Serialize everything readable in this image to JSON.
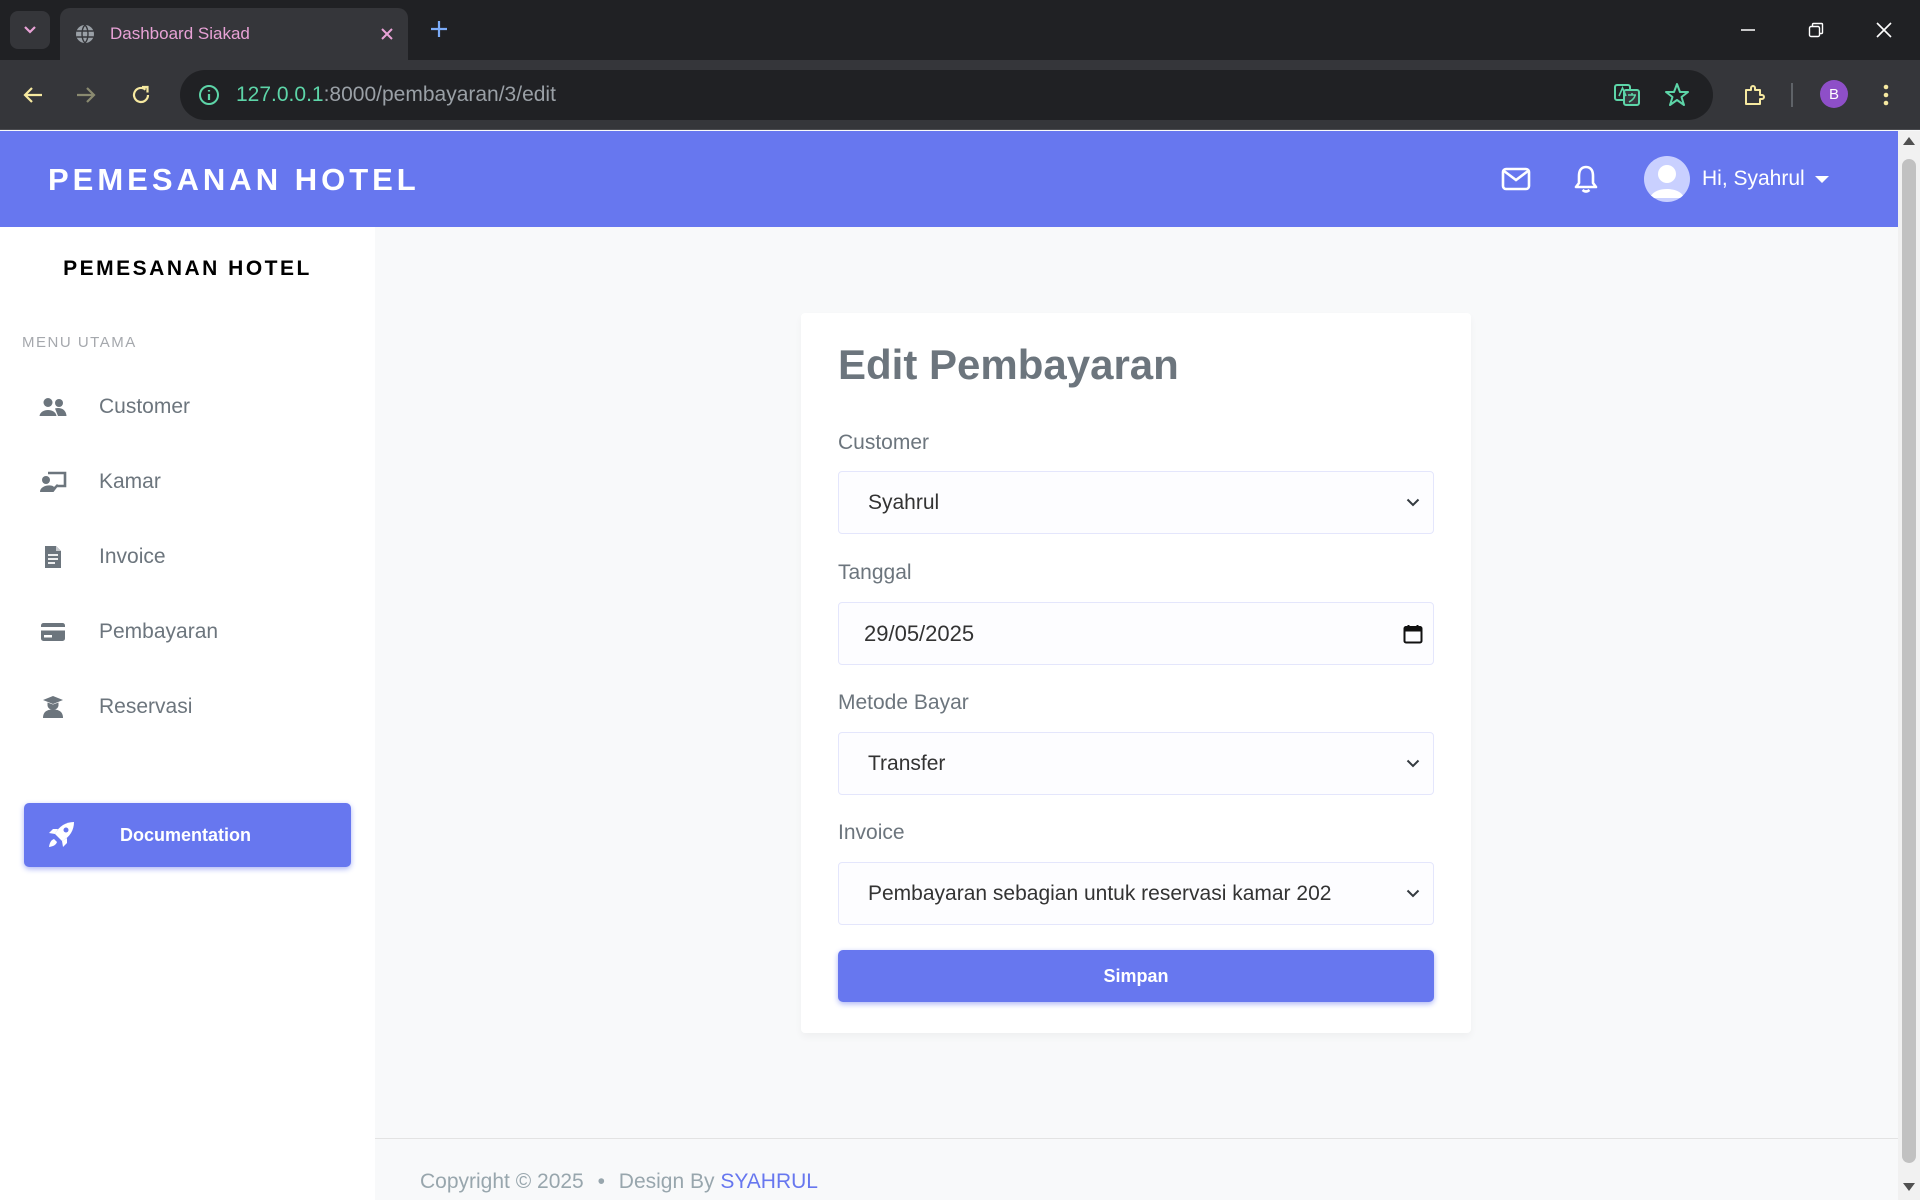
{
  "browser": {
    "tab_title": "Dashboard Siakad",
    "url_host": "127.0.0.1",
    "url_rest": ":8000/pembayaran/3/edit",
    "profile_initial": "B"
  },
  "header": {
    "brand": "PEMESANAN HOTEL",
    "greeting": "Hi, Syahrul"
  },
  "sidebar": {
    "brand": "PEMESANAN HOTEL",
    "menu_header": "MENU UTAMA",
    "items": [
      {
        "label": "Customer",
        "icon": "users-icon"
      },
      {
        "label": "Kamar",
        "icon": "chalkboard-teacher-icon"
      },
      {
        "label": "Invoice",
        "icon": "file-invoice-icon"
      },
      {
        "label": "Pembayaran",
        "icon": "credit-card-icon"
      },
      {
        "label": "Reservasi",
        "icon": "user-graduate-icon"
      }
    ],
    "doc_button": "Documentation"
  },
  "form": {
    "title": "Edit Pembayaran",
    "customer": {
      "label": "Customer",
      "value": "Syahrul"
    },
    "tanggal": {
      "label": "Tanggal",
      "value": "29/05/2025"
    },
    "metode": {
      "label": "Metode Bayar",
      "value": "Transfer"
    },
    "invoice": {
      "label": "Invoice",
      "value": "Pembayaran sebagian untuk reservasi kamar 202"
    },
    "submit": "Simpan"
  },
  "footer": {
    "copyright": "Copyright © 2025",
    "separator": "•",
    "design_by": "Design By",
    "author": "SYAHRUL"
  },
  "colors": {
    "primary": "#6777ef",
    "muted_text": "#6c757d",
    "url_host": "#5dd5a8",
    "tab_title": "#e8a2d6"
  }
}
